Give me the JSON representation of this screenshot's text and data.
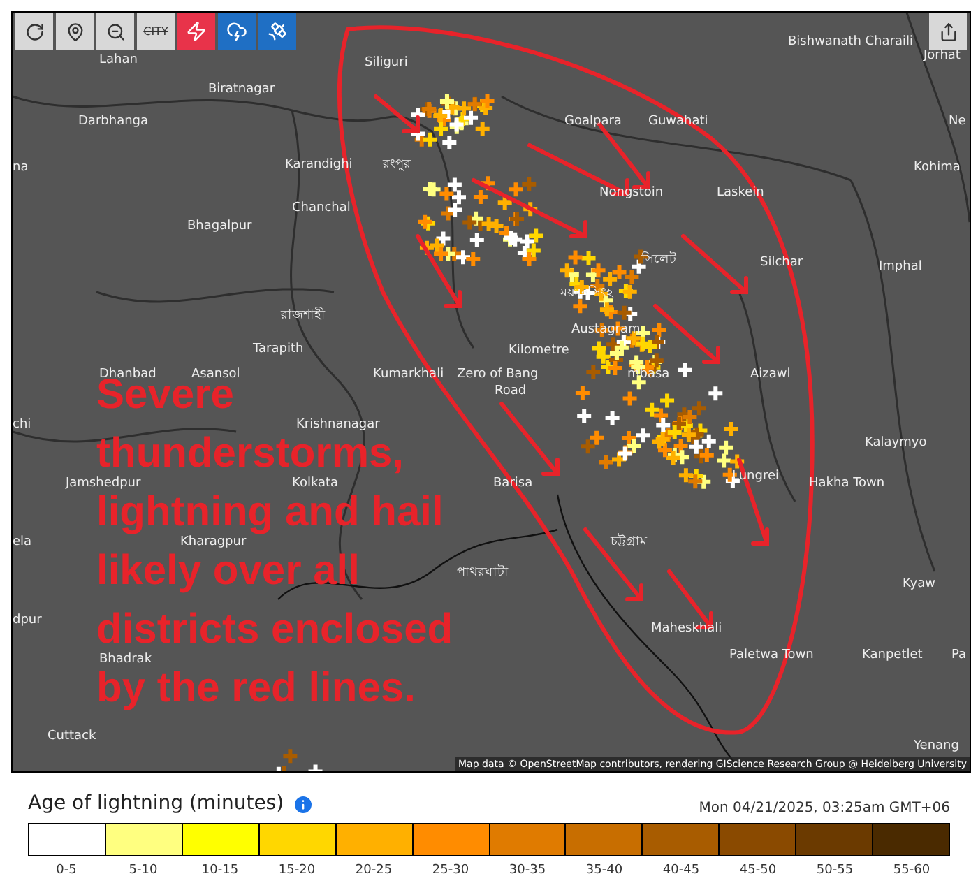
{
  "toolbar": [
    {
      "kind": "refresh",
      "on": false
    },
    {
      "kind": "pin",
      "on": false
    },
    {
      "kind": "zoom",
      "on": false
    },
    {
      "kind": "city",
      "label": "CITY",
      "on": false
    },
    {
      "kind": "strikes",
      "on": true,
      "color": "#e8334a"
    },
    {
      "kind": "ground",
      "on": true,
      "color": "#1f6fc4"
    },
    {
      "kind": "satellite",
      "on": true,
      "color": "#1f6fc4"
    }
  ],
  "map": {
    "places": [
      {
        "name": "Bishwanath Charaili"
      },
      {
        "name": "Jorhat"
      },
      {
        "name": "Lahan"
      },
      {
        "name": "Siliguri"
      },
      {
        "name": "Biratnagar"
      },
      {
        "name": "Darbhanga"
      },
      {
        "name": "Goalpara"
      },
      {
        "name": "Guwahati"
      },
      {
        "name": "Ne"
      },
      {
        "name": "na"
      },
      {
        "name": "Karandighi"
      },
      {
        "name": "রংপুর"
      },
      {
        "name": "Kohima"
      },
      {
        "name": "Nongstoin"
      },
      {
        "name": "Laskein"
      },
      {
        "name": "Chanchal"
      },
      {
        "name": "Bhagalpur"
      },
      {
        "name": "সিলেট"
      },
      {
        "name": "Silchar"
      },
      {
        "name": "Imphal"
      },
      {
        "name": "ময়মনসিংহ"
      },
      {
        "name": "রাজশাহী"
      },
      {
        "name": "Austagram"
      },
      {
        "name": "Tarapith"
      },
      {
        "name": "Kilometre"
      },
      {
        "name": "Dhanbad"
      },
      {
        "name": "Asansol"
      },
      {
        "name": "Kumarkhali"
      },
      {
        "name": "Zero of Bang"
      },
      {
        "name": "mbasa"
      },
      {
        "name": "Aizawl"
      },
      {
        "name": "Road"
      },
      {
        "name": "chi"
      },
      {
        "name": "Krishnanagar"
      },
      {
        "name": "Kalaymyo"
      },
      {
        "name": "Lungrei"
      },
      {
        "name": "Jamshedpur"
      },
      {
        "name": "Kolkata"
      },
      {
        "name": "Barisa"
      },
      {
        "name": "Hakha Town"
      },
      {
        "name": "ela"
      },
      {
        "name": "Kharagpur"
      },
      {
        "name": "চট্টগ্রাম"
      },
      {
        "name": "পাথরঘাটা"
      },
      {
        "name": "Kyaw"
      },
      {
        "name": "dpur"
      },
      {
        "name": "Maheskhali"
      },
      {
        "name": "Bhadrak"
      },
      {
        "name": "Paletwa Town"
      },
      {
        "name": "Kanpetlet"
      },
      {
        "name": "Pa"
      },
      {
        "name": "Cuttack"
      },
      {
        "name": "Yenang"
      }
    ],
    "annotation": [
      "Severe",
      "thunderstorms,",
      "lightning and hail",
      "likely over all",
      "districts enclosed",
      "by the red lines."
    ],
    "attribution": "Map data © OpenStreetMap contributors, rendering GIScience Research Group @ Heidelberg University"
  },
  "legend": {
    "title": "Age of lightning (minutes)",
    "timestamp": "Mon 04/21/2025, 03:25am GMT+06",
    "items": [
      {
        "label": "0-5",
        "color": "#ffffff"
      },
      {
        "label": "5-10",
        "color": "#ffff80"
      },
      {
        "label": "10-15",
        "color": "#ffff00"
      },
      {
        "label": "15-20",
        "color": "#ffd700"
      },
      {
        "label": "20-25",
        "color": "#ffb000"
      },
      {
        "label": "25-30",
        "color": "#ff8c00"
      },
      {
        "label": "30-35",
        "color": "#e07b00"
      },
      {
        "label": "35-40",
        "color": "#c86e00"
      },
      {
        "label": "40-45",
        "color": "#a85c00"
      },
      {
        "label": "45-50",
        "color": "#8a4a00"
      },
      {
        "label": "50-55",
        "color": "#6b3a00"
      },
      {
        "label": "55-60",
        "color": "#4a2a00"
      }
    ]
  }
}
